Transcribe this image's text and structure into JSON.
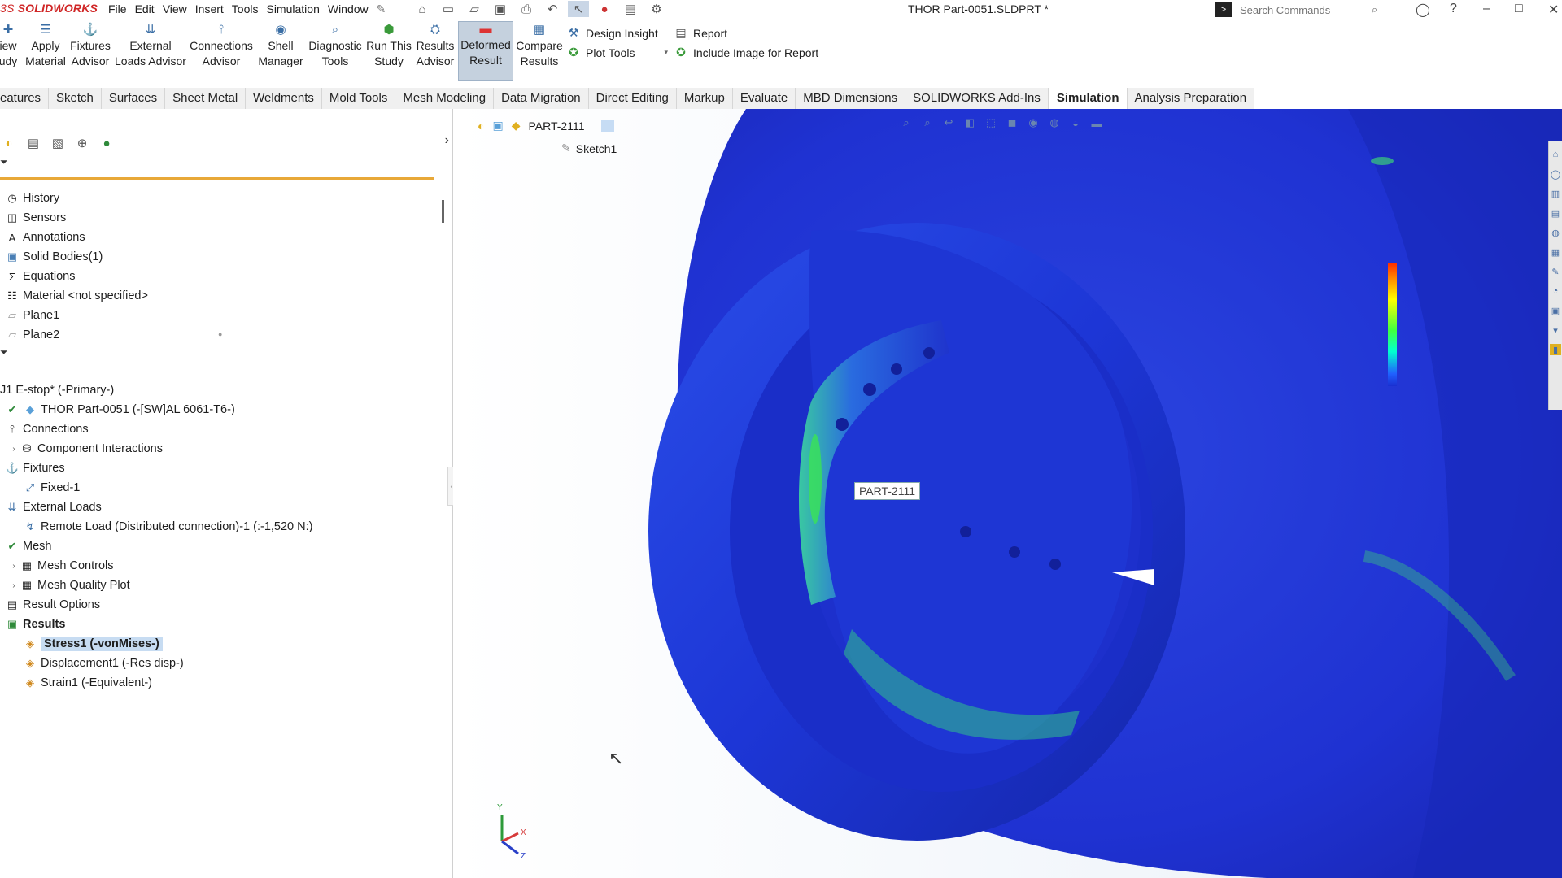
{
  "app": {
    "logo_prefix": "3S",
    "logo_text": "SOLIDWORKS",
    "document_title": "THOR Part-0051.SLDPRT *",
    "search_placeholder": "Search Commands"
  },
  "menu": [
    "File",
    "Edit",
    "View",
    "Insert",
    "Tools",
    "Simulation",
    "Window"
  ],
  "ribbon": {
    "buttons": [
      {
        "label1": "iew",
        "label2": "udy",
        "icon": "new-study-icon"
      },
      {
        "label1": "Apply",
        "label2": "Material",
        "icon": "apply-material-icon"
      },
      {
        "label1": "Fixtures",
        "label2": "Advisor",
        "icon": "fixtures-icon"
      },
      {
        "label1": "External",
        "label2": "Loads Advisor",
        "icon": "external-loads-icon"
      },
      {
        "label1": "Connections",
        "label2": "Advisor",
        "icon": "connections-icon"
      },
      {
        "label1": "Shell",
        "label2": "Manager",
        "icon": "shell-icon"
      },
      {
        "label1": "Diagnostic",
        "label2": "Tools",
        "icon": "diagnostic-icon"
      },
      {
        "label1": "Run This",
        "label2": "Study",
        "icon": "run-icon"
      },
      {
        "label1": "Results",
        "label2": "Advisor",
        "icon": "results-advisor-icon"
      },
      {
        "label1": "Deformed",
        "label2": "Result",
        "icon": "deformed-icon"
      },
      {
        "label1": "Compare",
        "label2": "Results",
        "icon": "compare-icon"
      }
    ],
    "design_insight": "Design Insight",
    "plot_tools": "Plot Tools",
    "report": "Report",
    "include_image": "Include Image for Report"
  },
  "tabs": [
    "eatures",
    "Sketch",
    "Surfaces",
    "Sheet Metal",
    "Weldments",
    "Mold Tools",
    "Mesh Modeling",
    "Data Migration",
    "Direct Editing",
    "Markup",
    "Evaluate",
    "MBD Dimensions",
    "SOLIDWORKS Add-Ins",
    "Simulation",
    "Analysis Preparation"
  ],
  "active_tab": "Simulation",
  "feature_tree": [
    {
      "label": "History",
      "icon": "history-icon"
    },
    {
      "label": "Sensors",
      "icon": "sensors-icon"
    },
    {
      "label": "Annotations",
      "icon": "annotations-icon"
    },
    {
      "label": "Solid Bodies(1)",
      "icon": "solid-bodies-icon"
    },
    {
      "label": "Equations",
      "icon": "equations-icon"
    },
    {
      "label": "Material <not specified>",
      "icon": "material-icon"
    },
    {
      "label": "Plane1",
      "icon": "plane-icon"
    },
    {
      "label": "Plane2",
      "icon": "plane-icon"
    }
  ],
  "study_tree": {
    "root": "J1 E-stop* (-Primary-)",
    "items": [
      {
        "label": "THOR Part-0051 (-[SW]AL 6061-T6-)",
        "icon": "part-icon",
        "indent": 1
      },
      {
        "label": "Connections",
        "icon": "connections-icon",
        "indent": 0
      },
      {
        "label": "Component Interactions",
        "icon": "component-interactions-icon",
        "indent": 1,
        "expander": true
      },
      {
        "label": "Fixtures",
        "icon": "fixtures-icon",
        "indent": 0
      },
      {
        "label": "Fixed-1",
        "icon": "fixed-icon",
        "indent": 1
      },
      {
        "label": "External Loads",
        "icon": "external-loads-icon",
        "indent": 0
      },
      {
        "label": "Remote Load (Distributed connection)-1 (:-1,520 N:)",
        "icon": "remote-load-icon",
        "indent": 1
      },
      {
        "label": "Mesh",
        "icon": "mesh-icon",
        "indent": 0
      },
      {
        "label": "Mesh Controls",
        "icon": "mesh-controls-icon",
        "indent": 1,
        "expander": true
      },
      {
        "label": "Mesh Quality Plot",
        "icon": "mesh-quality-icon",
        "indent": 1,
        "expander": true
      },
      {
        "label": "Result Options",
        "icon": "result-options-icon",
        "indent": 0
      },
      {
        "label": "Results",
        "icon": "results-icon",
        "indent": 0,
        "bold": true
      },
      {
        "label": "Stress1 (-vonMises-)",
        "icon": "stress-plot-icon",
        "indent": 1,
        "selected": true
      },
      {
        "label": "Displacement1 (-Res disp-)",
        "icon": "displacement-plot-icon",
        "indent": 1
      },
      {
        "label": "Strain1 (-Equivalent-)",
        "icon": "strain-plot-icon",
        "indent": 1
      }
    ]
  },
  "viewport": {
    "flyout_part": "PART-2111",
    "flyout_sketch": "Sketch1",
    "callout_label": "PART-2111",
    "triad": {
      "x": "X",
      "y": "Y",
      "z": "Z"
    }
  },
  "colors": {
    "accent": "#3a6ea5",
    "logo_red": "#d02727",
    "selection": "#c7dcf2",
    "model_blue": "#1f2fd6"
  }
}
